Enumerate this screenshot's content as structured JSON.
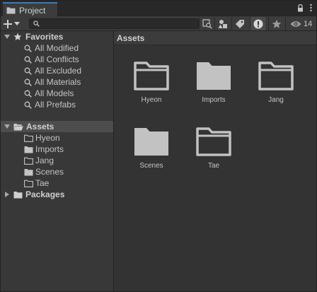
{
  "window": {
    "tab_title": "Project",
    "tab_icon": "folder-icon"
  },
  "toolbar": {
    "create_icon": "plus-icon",
    "search_placeholder": "",
    "hidden_count": "14"
  },
  "favorites": {
    "label": "Favorites",
    "items": [
      {
        "label": "All Modified"
      },
      {
        "label": "All Conflicts"
      },
      {
        "label": "All Excluded"
      },
      {
        "label": "All Materials"
      },
      {
        "label": "All Models"
      },
      {
        "label": "All Prefabs"
      }
    ]
  },
  "assets_tree": {
    "label": "Assets",
    "children": [
      {
        "label": "Hyeon"
      },
      {
        "label": "Imports"
      },
      {
        "label": "Jang"
      },
      {
        "label": "Scenes"
      },
      {
        "label": "Tae"
      }
    ]
  },
  "packages": {
    "label": "Packages"
  },
  "content": {
    "breadcrumb": "Assets",
    "items": [
      {
        "label": "Hyeon",
        "filled": false
      },
      {
        "label": "Imports",
        "filled": true
      },
      {
        "label": "Jang",
        "filled": false
      },
      {
        "label": "Scenes",
        "filled": true
      },
      {
        "label": "Tae",
        "filled": false
      }
    ]
  },
  "colors": {
    "background": "#383838",
    "content_bg": "#333333",
    "selection": "#4d4d4d",
    "tab_accent": "#3a79bb",
    "folder": "#c2c2c2"
  }
}
